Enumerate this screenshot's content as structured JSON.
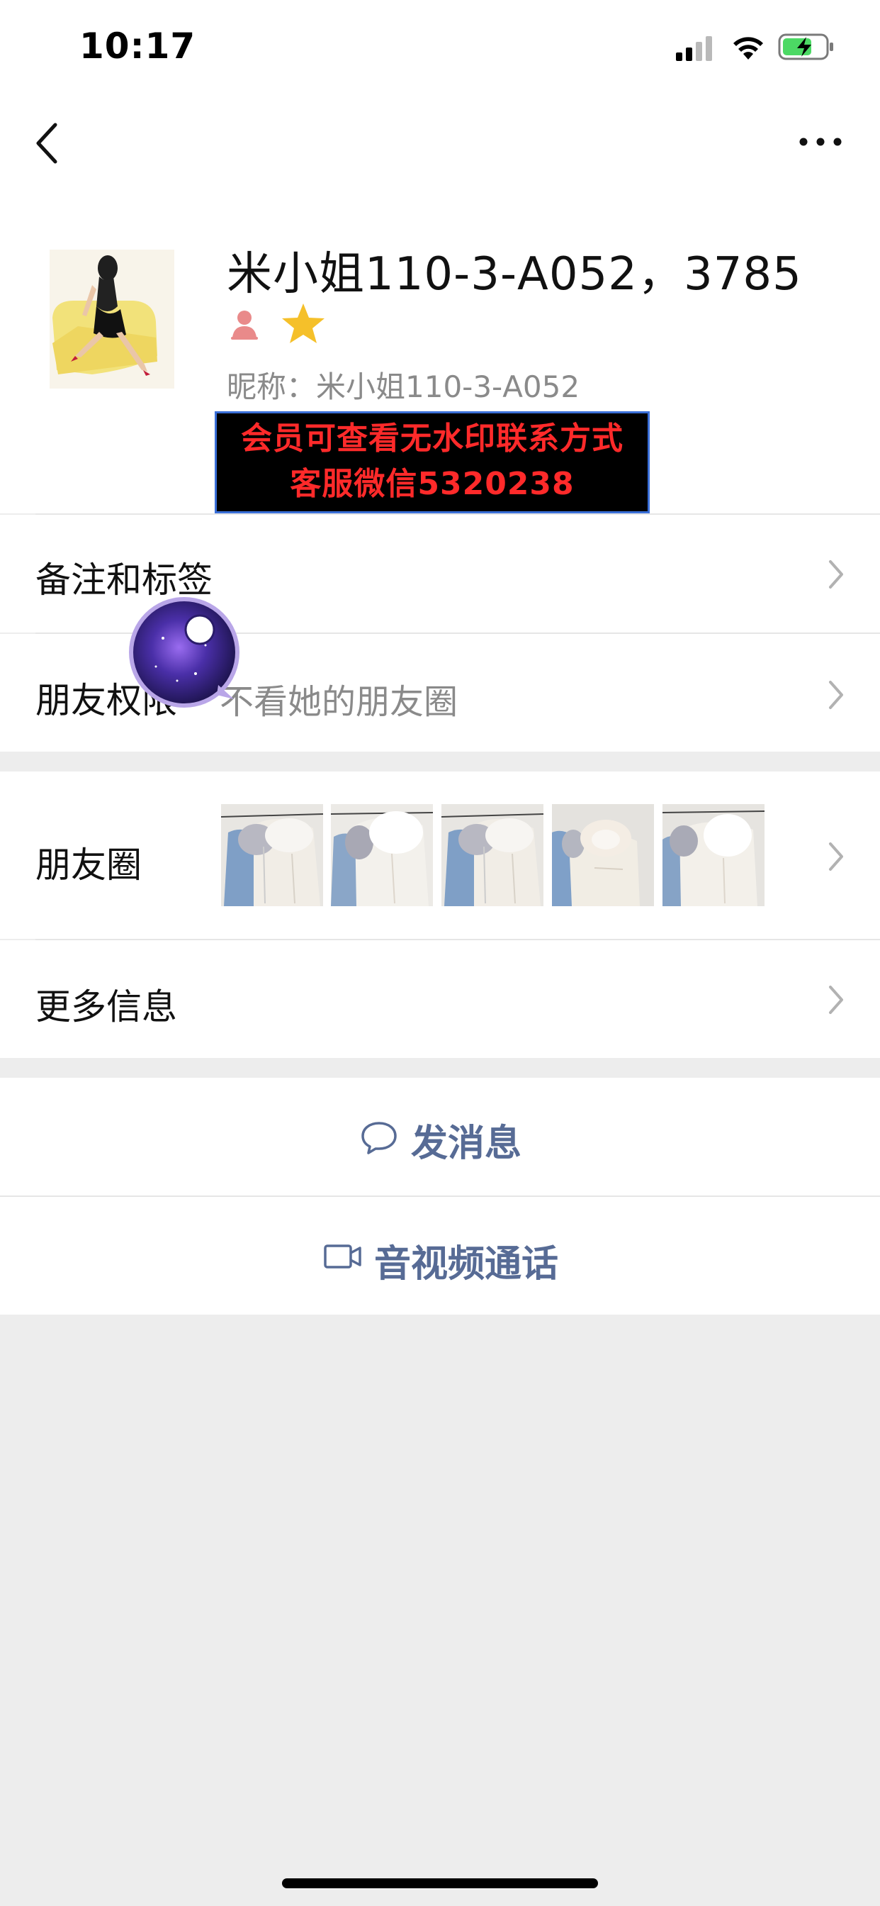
{
  "status_bar": {
    "time": "10:17",
    "icons": [
      "cellular-signal-icon",
      "wifi-icon",
      "battery-charging-icon"
    ]
  },
  "nav": {
    "back_icon": "chevron-left-icon",
    "more_icon": "more-horizontal-icon"
  },
  "profile": {
    "name": "米小姐110-3-A052，3785",
    "gender_icon": "person-female-icon",
    "star_icon": "star-icon",
    "nickname": "昵称：米小姐110-3-A052",
    "banner_line1": "会员可查看无水印联系方式",
    "banner_line2": "客服微信5320238",
    "colors": {
      "banner_bg": "#000000",
      "banner_text": "#ff2a2a",
      "star": "#f5c02a"
    }
  },
  "cells": {
    "remarks_label": "备注和标签",
    "permissions_label": "朋友权限",
    "permissions_value": "不看她的朋友圈",
    "moments_label": "朋友圈",
    "more_info_label": "更多信息"
  },
  "actions": {
    "message_label": "发消息",
    "call_label": "音视频通话",
    "link_color": "#576b95"
  }
}
